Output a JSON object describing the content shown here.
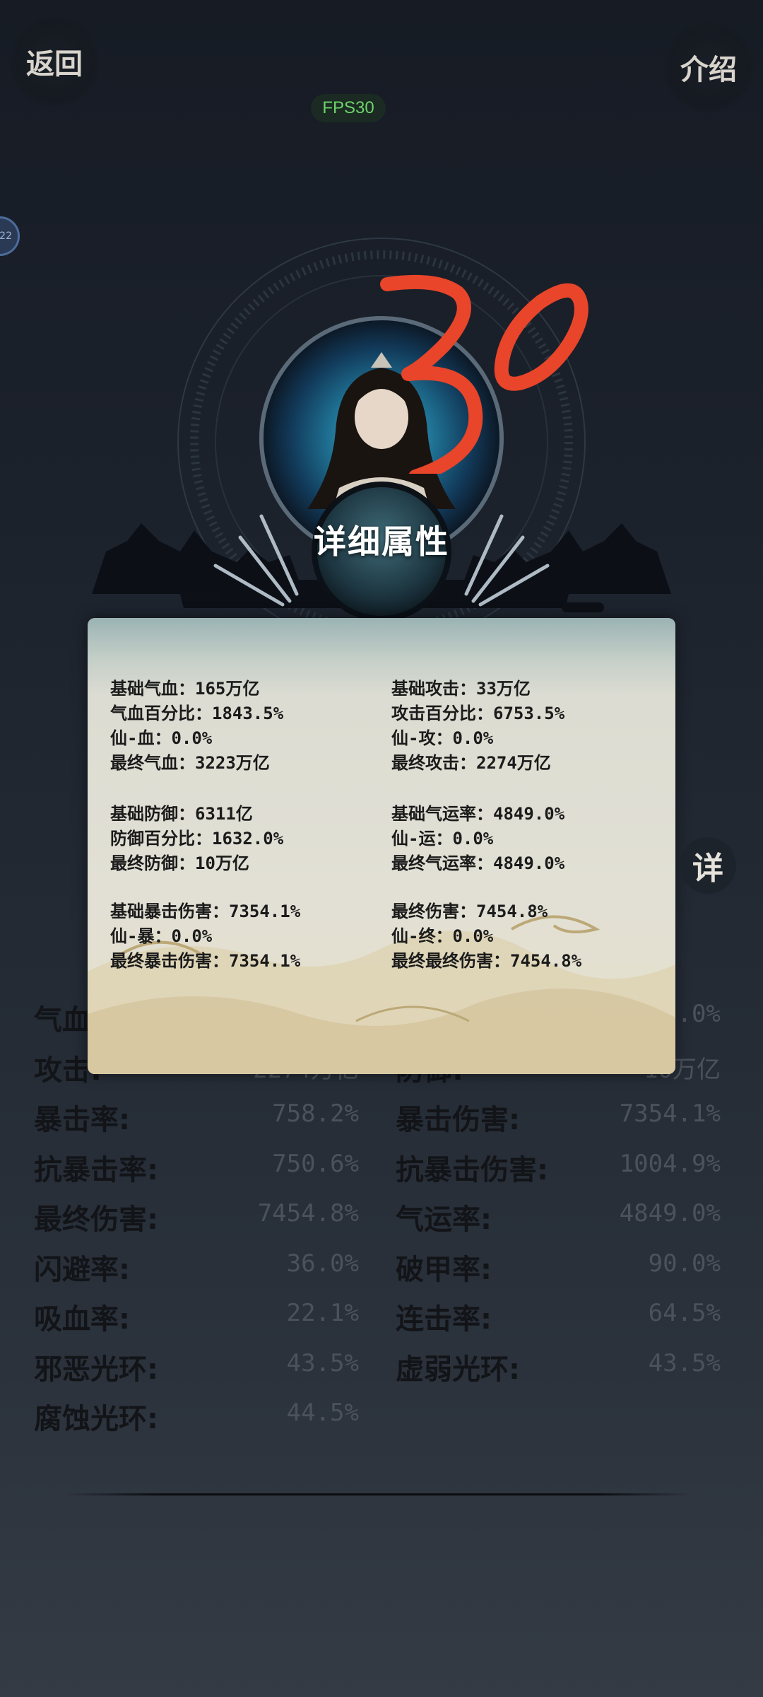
{
  "header": {
    "back_label": "返回",
    "intro_label": "介绍",
    "fps_label": "FPS30",
    "side_badge": "22",
    "detail_button": "详"
  },
  "annotation_text": "30",
  "modal": {
    "title": "详细属性",
    "groups": [
      {
        "left": [
          "基础气血：165万亿",
          "气血百分比：1843.5%",
          "仙-血：0.0%",
          "最终气血：3223万亿"
        ],
        "right": [
          "基础攻击：33万亿",
          "攻击百分比：6753.5%",
          "仙-攻：0.0%",
          "最终攻击：2274万亿"
        ]
      },
      {
        "left": [
          "基础防御：6311亿",
          "防御百分比：1632.0%",
          "最终防御：10万亿"
        ],
        "right": [
          "基础气运率：4849.0%",
          "仙-运：0.0%",
          "最终气运率：4849.0%"
        ]
      },
      {
        "left": [
          "基础暴击伤害：7354.1%",
          "仙-暴：0.0%",
          "最终暴击伤害：7354.1%"
        ],
        "right": [
          "最终伤害：7454.8%",
          "仙-终：0.0%",
          "最终最终伤害：7454.8%"
        ]
      }
    ]
  },
  "background_stats": [
    {
      "left": {
        "label": "气血:",
        "value": ""
      },
      "right": {
        "label": "",
        "value": ".0%"
      }
    },
    {
      "left": {
        "label": "攻击:",
        "value": "2274万亿"
      },
      "right": {
        "label": "防御:",
        "value": "10万亿"
      }
    },
    {
      "left": {
        "label": "暴击率:",
        "value": "758.2%"
      },
      "right": {
        "label": "暴击伤害:",
        "value": "7354.1%"
      }
    },
    {
      "left": {
        "label": "抗暴击率:",
        "value": "750.6%"
      },
      "right": {
        "label": "抗暴击伤害:",
        "value": "1004.9%"
      }
    },
    {
      "left": {
        "label": "最终伤害:",
        "value": "7454.8%"
      },
      "right": {
        "label": "气运率:",
        "value": "4849.0%"
      }
    },
    {
      "left": {
        "label": "闪避率:",
        "value": "36.0%"
      },
      "right": {
        "label": "破甲率:",
        "value": "90.0%"
      }
    },
    {
      "left": {
        "label": "吸血率:",
        "value": "22.1%"
      },
      "right": {
        "label": "连击率:",
        "value": "64.5%"
      }
    },
    {
      "left": {
        "label": "邪恶光环:",
        "value": "43.5%"
      },
      "right": {
        "label": "虚弱光环:",
        "value": "43.5%"
      }
    },
    {
      "left": {
        "label": "腐蚀光环:",
        "value": "44.5%"
      },
      "right": {
        "label": "",
        "value": ""
      }
    }
  ],
  "colors": {
    "annotation": "#e8452a",
    "fps": "#6ed36b",
    "stat_label": "#121418",
    "stat_value": "#4c525a"
  }
}
